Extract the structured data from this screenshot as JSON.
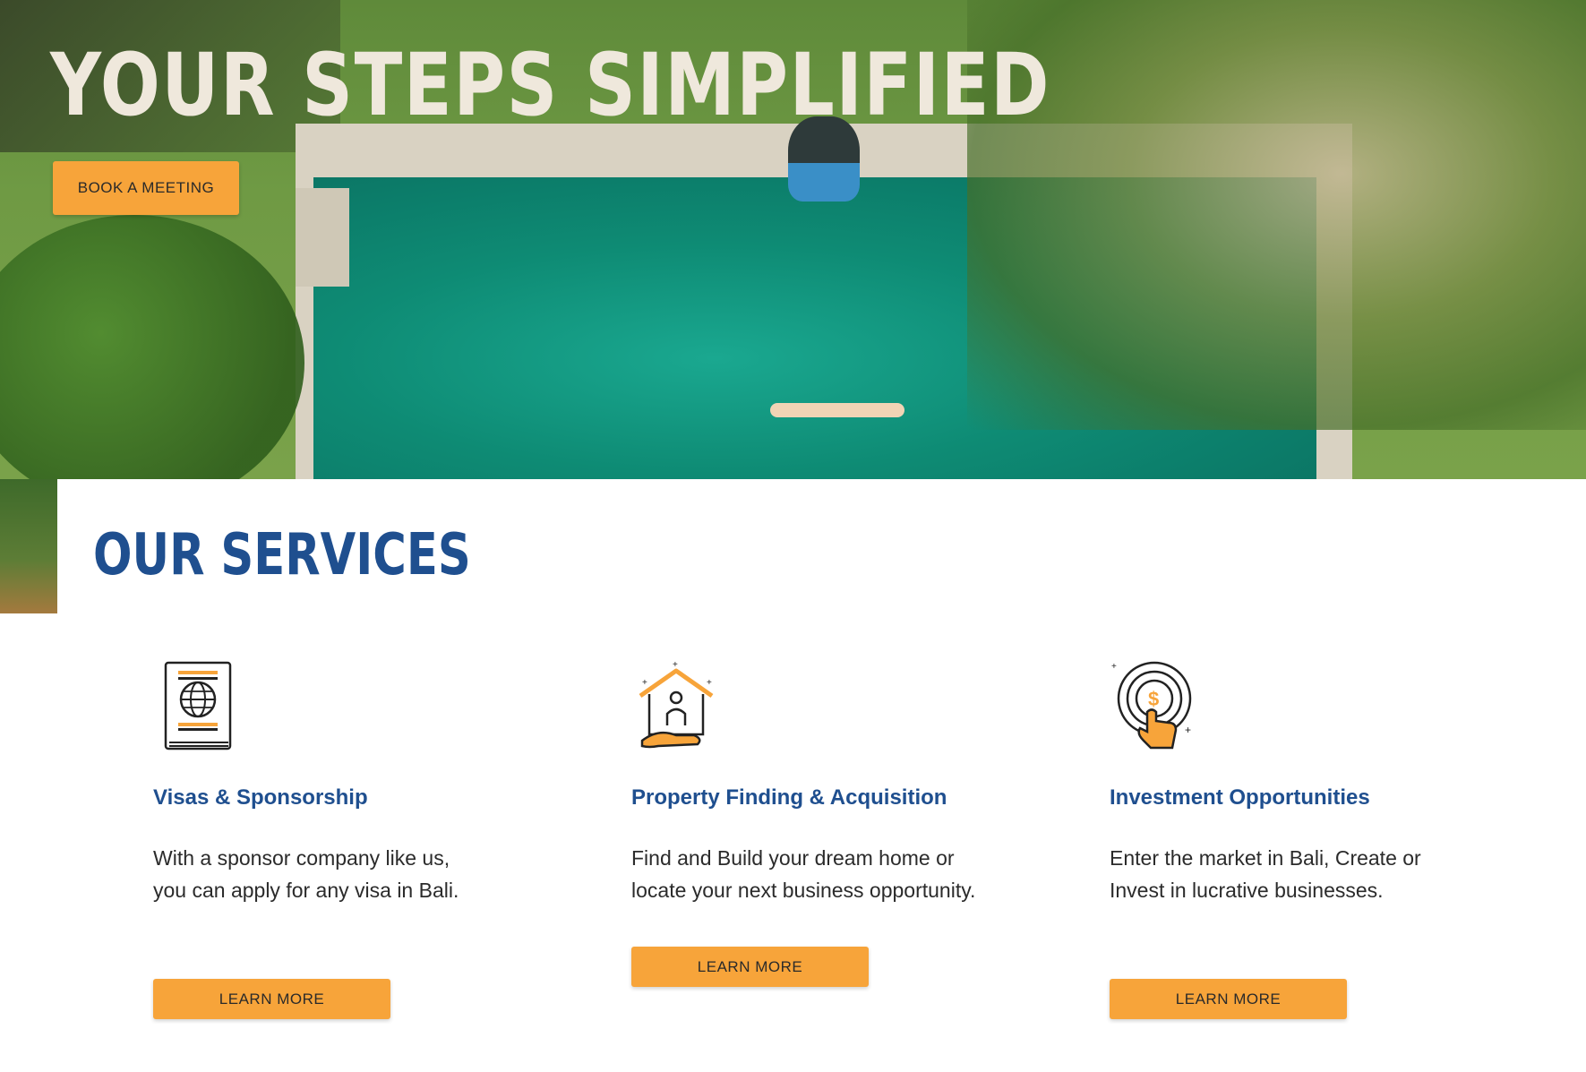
{
  "hero": {
    "title": "YOUR STEPS SIMPLIFIED",
    "cta_label": "BOOK A MEETING"
  },
  "services": {
    "heading": "OUR SERVICES",
    "items": [
      {
        "icon": "passport-icon",
        "title": "Visas & Sponsorship",
        "description": "With a sponsor company like us, you can apply for any visa in Bali.",
        "button_label": "LEARN MORE"
      },
      {
        "icon": "house-hand-icon",
        "title": "Property Finding & Acquisition",
        "description": "Find and Build your dream home or locate your next business opportunity.",
        "button_label": "LEARN MORE"
      },
      {
        "icon": "dollar-target-icon",
        "title": "Investment Opportunities",
        "description": "Enter the market in Bali, Create or Invest in lucrative businesses.",
        "button_label": "LEARN MORE"
      }
    ]
  },
  "colors": {
    "accent": "#f7a43a",
    "heading_blue": "#1f4f8f",
    "hero_title": "#efe8dc"
  }
}
